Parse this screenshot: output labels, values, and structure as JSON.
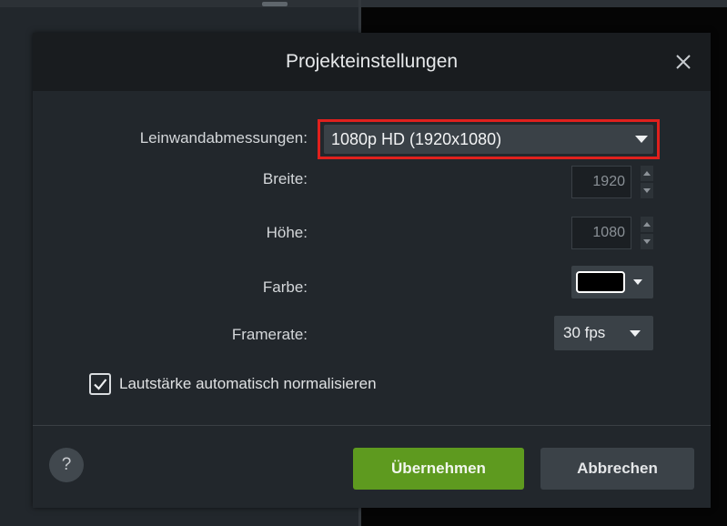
{
  "dialog": {
    "title": "Projekteinstellungen",
    "close_icon": "close-icon"
  },
  "canvas": {
    "label": "Leinwandabmessungen:",
    "value": "1080p HD (1920x1080)",
    "highlight_color": "#e0201d"
  },
  "width": {
    "label": "Breite:",
    "value": "1920"
  },
  "height": {
    "label": "Höhe:",
    "value": "1080"
  },
  "color": {
    "label": "Farbe:",
    "value": "#000000"
  },
  "framerate": {
    "label": "Framerate:",
    "value": "30 fps"
  },
  "normalize": {
    "label": "Lautstärke automatisch normalisieren",
    "checked": true
  },
  "footer": {
    "help_label": "?",
    "apply_label": "Übernehmen",
    "cancel_label": "Abbrechen",
    "apply_color": "#5e9a1f"
  }
}
